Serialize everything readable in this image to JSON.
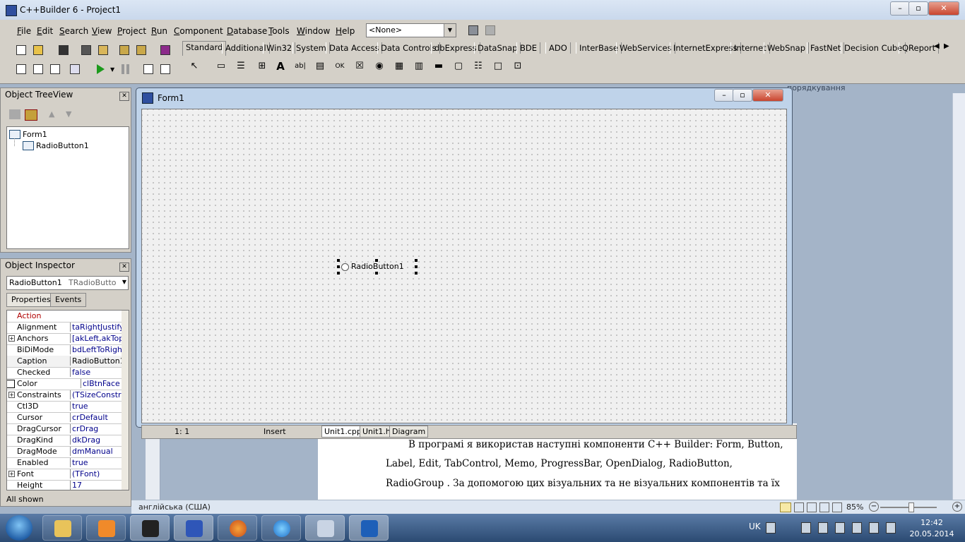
{
  "app": {
    "title": "C++Builder 6 - Project1"
  },
  "menu": [
    "File",
    "Edit",
    "Search",
    "View",
    "Project",
    "Run",
    "Component",
    "Database",
    "Tools",
    "Window",
    "Help"
  ],
  "desktop_combo": {
    "value": "<None>"
  },
  "palette_tabs": [
    "Standard",
    "Additional",
    "Win32",
    "System",
    "Data Access",
    "Data Controls",
    "dbExpress",
    "DataSnap",
    "BDE",
    "ADO",
    "InterBase",
    "WebServices",
    "InternetExpress",
    "Internet",
    "WebSnap",
    "FastNet",
    "Decision Cube",
    "QReport"
  ],
  "tree_view": {
    "title": "Object TreeView",
    "items": [
      "Form1",
      "RadioButton1"
    ]
  },
  "inspector": {
    "title": "Object Inspector",
    "object_name": "RadioButton1",
    "object_type": "TRadioButton",
    "tabs": [
      "Properties",
      "Events"
    ],
    "properties": [
      {
        "name": "Action",
        "value": "",
        "plus": false
      },
      {
        "name": "Alignment",
        "value": "taRightJustify",
        "plus": false
      },
      {
        "name": "Anchors",
        "value": "[akLeft,akTop]",
        "plus": true
      },
      {
        "name": "BiDiMode",
        "value": "bdLeftToRight",
        "plus": false
      },
      {
        "name": "Caption",
        "value": "RadioButton1",
        "plus": false
      },
      {
        "name": "Checked",
        "value": "false",
        "plus": false
      },
      {
        "name": "Color",
        "value": "clBtnFace",
        "plus": false
      },
      {
        "name": "Constraints",
        "value": "(TSizeConstraints)",
        "plus": true
      },
      {
        "name": "Ctl3D",
        "value": "true",
        "plus": false
      },
      {
        "name": "Cursor",
        "value": "crDefault",
        "plus": false
      },
      {
        "name": "DragCursor",
        "value": "crDrag",
        "plus": false
      },
      {
        "name": "DragKind",
        "value": "dkDrag",
        "plus": false
      },
      {
        "name": "DragMode",
        "value": "dmManual",
        "plus": false
      },
      {
        "name": "Enabled",
        "value": "true",
        "plus": false
      },
      {
        "name": "Font",
        "value": "(TFont)",
        "plus": true
      },
      {
        "name": "Height",
        "value": "17",
        "plus": false
      }
    ],
    "status": "All shown"
  },
  "form": {
    "title": "Form1",
    "radio_caption": "RadioButton1"
  },
  "editor_status": {
    "position": "1:   1",
    "mode": "Insert",
    "tabs": [
      "Unit1.cpp",
      "Unit1.h",
      "Diagram"
    ]
  },
  "word": {
    "partial_header": "порядкування",
    "lines": [
      "В програмі я використав наступні компоненти C++ Builder: Form, Button,",
      "Label, Edit, TabControl, Memo, ProgressBar, OpenDialog, RadioButton,",
      "RadioGroup . За допомогою цих візуальних та не візуальних компонентів та їх"
    ],
    "language": "англійська (США)",
    "zoom": "85%"
  },
  "taskbar": {
    "apps": [
      "explorer",
      "media-player",
      "mpc",
      "cpp-builder",
      "firefox",
      "internet-explorer",
      "search",
      "word"
    ],
    "lang": "UK",
    "time": "12:42",
    "date": "20.05.2014"
  }
}
